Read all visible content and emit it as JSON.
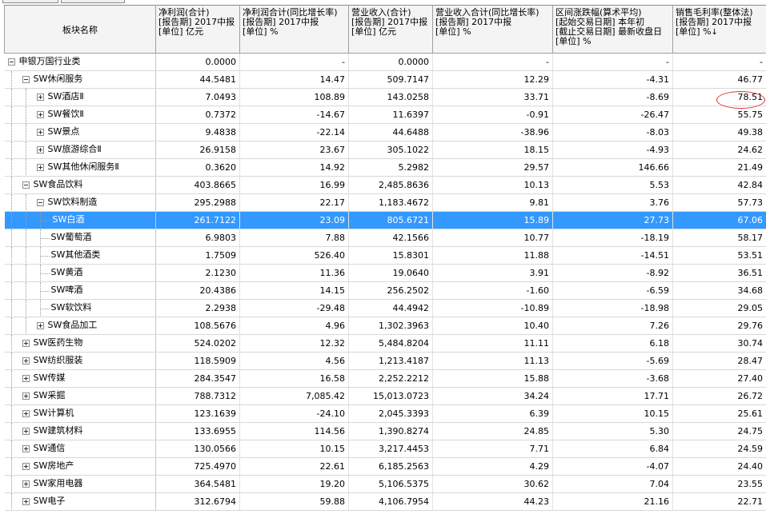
{
  "header": {
    "col0": "板块名称",
    "cols": [
      {
        "line1": "净利润(合计)",
        "line2": "[报告期] 2017中报",
        "line3": "[单位] 亿元"
      },
      {
        "line1": "净利润合计(同比增长率)",
        "line2": "[报告期] 2017中报",
        "line3": "[单位] %"
      },
      {
        "line1": "营业收入(合计)",
        "line2": "[报告期] 2017中报",
        "line3": "[单位] 亿元"
      },
      {
        "line1": "营业收入合计(同比增长率)",
        "line2": "[报告期] 2017中报",
        "line3": "[单位] %"
      },
      {
        "line1": "区间涨跌幅(算术平均)",
        "line2": "[起始交易日期] 本年初",
        "line3": "[截止交易日期] 最新收盘日",
        "line4": "[单位] %"
      },
      {
        "line1": "销售毛利率(整体法)",
        "line2": "[报告期] 2017中报",
        "line3": "[单位] %",
        "sort_icon": "sort-down-arrow"
      }
    ]
  },
  "rows": [
    {
      "name": "申银万国行业类",
      "v": [
        "0.0000",
        "-",
        "0.0000",
        "-",
        "-",
        "-"
      ]
    },
    {
      "name": "SW休闲服务",
      "v": [
        "44.5481",
        "14.47",
        "509.7147",
        "12.29",
        "-4.31",
        "46.77"
      ]
    },
    {
      "name": "SW酒店Ⅱ",
      "v": [
        "7.0493",
        "108.89",
        "143.0258",
        "33.71",
        "-8.69",
        "78.51"
      ]
    },
    {
      "name": "SW餐饮Ⅱ",
      "v": [
        "0.7372",
        "-14.67",
        "11.6397",
        "-0.91",
        "-26.47",
        "55.75"
      ]
    },
    {
      "name": "SW景点",
      "v": [
        "9.4838",
        "-22.14",
        "44.6488",
        "-38.96",
        "-8.03",
        "49.38"
      ]
    },
    {
      "name": "SW旅游综合Ⅱ",
      "v": [
        "26.9158",
        "23.67",
        "305.1022",
        "18.15",
        "-4.93",
        "24.62"
      ]
    },
    {
      "name": "SW其他休闲服务Ⅱ",
      "v": [
        "0.3620",
        "14.92",
        "5.2982",
        "29.57",
        "146.66",
        "21.49"
      ]
    },
    {
      "name": "SW食品饮料",
      "v": [
        "403.8665",
        "16.99",
        "2,485.8636",
        "10.13",
        "5.53",
        "42.84"
      ]
    },
    {
      "name": "SW饮料制造",
      "v": [
        "295.2988",
        "22.17",
        "1,183.4672",
        "9.81",
        "3.76",
        "57.73"
      ]
    },
    {
      "name": "SW白酒",
      "v": [
        "261.7122",
        "23.09",
        "805.6721",
        "15.89",
        "27.73",
        "67.06"
      ]
    },
    {
      "name": "SW葡萄酒",
      "v": [
        "6.9803",
        "7.88",
        "42.1566",
        "10.77",
        "-18.19",
        "58.17"
      ]
    },
    {
      "name": "SW其他酒类",
      "v": [
        "1.7509",
        "526.40",
        "15.8301",
        "11.88",
        "-14.51",
        "53.51"
      ]
    },
    {
      "name": "SW黄酒",
      "v": [
        "2.1230",
        "11.36",
        "19.0640",
        "3.91",
        "-8.92",
        "36.51"
      ]
    },
    {
      "name": "SW啤酒",
      "v": [
        "20.4386",
        "14.15",
        "256.2502",
        "-1.60",
        "-6.59",
        "34.68"
      ]
    },
    {
      "name": "SW软饮料",
      "v": [
        "2.2938",
        "-29.48",
        "44.4942",
        "-10.89",
        "-18.98",
        "29.05"
      ]
    },
    {
      "name": "SW食品加工",
      "v": [
        "108.5676",
        "4.96",
        "1,302.3963",
        "10.40",
        "7.26",
        "29.76"
      ]
    },
    {
      "name": "SW医药生物",
      "v": [
        "524.0202",
        "12.32",
        "5,484.8204",
        "11.11",
        "6.18",
        "30.74"
      ]
    },
    {
      "name": "SW纺织服装",
      "v": [
        "118.5909",
        "4.56",
        "1,213.4187",
        "11.13",
        "-5.69",
        "28.47"
      ]
    },
    {
      "name": "SW传媒",
      "v": [
        "284.3547",
        "16.58",
        "2,252.2212",
        "15.88",
        "-3.68",
        "27.40"
      ]
    },
    {
      "name": "SW采掘",
      "v": [
        "788.7312",
        "7,085.42",
        "15,013.0723",
        "34.24",
        "17.71",
        "26.72"
      ]
    },
    {
      "name": "SW计算机",
      "v": [
        "123.1639",
        "-24.10",
        "2,045.3393",
        "6.39",
        "10.15",
        "25.61"
      ]
    },
    {
      "name": "SW建筑材料",
      "v": [
        "133.6955",
        "114.56",
        "1,390.8274",
        "24.85",
        "5.30",
        "24.75"
      ]
    },
    {
      "name": "SW通信",
      "v": [
        "130.0566",
        "10.15",
        "3,217.4453",
        "7.71",
        "6.84",
        "24.59"
      ]
    },
    {
      "name": "SW房地产",
      "v": [
        "725.4970",
        "22.61",
        "6,185.2563",
        "4.29",
        "-4.07",
        "24.40"
      ]
    },
    {
      "name": "SW家用电器",
      "v": [
        "364.5481",
        "19.20",
        "5,106.5375",
        "30.62",
        "7.04",
        "23.55"
      ]
    },
    {
      "name": "SW电子",
      "v": [
        "312.6794",
        "59.88",
        "4,106.7954",
        "44.23",
        "21.16",
        "22.71"
      ]
    }
  ],
  "selected_row": "SW白酒",
  "highlight_annotation": {
    "row": "SW酒店Ⅱ",
    "value": "78.51",
    "color": "#e03030"
  },
  "colors": {
    "selection": "#3399ff",
    "header_bg": "#f4f4f4",
    "grid": "#d8d8d8"
  }
}
